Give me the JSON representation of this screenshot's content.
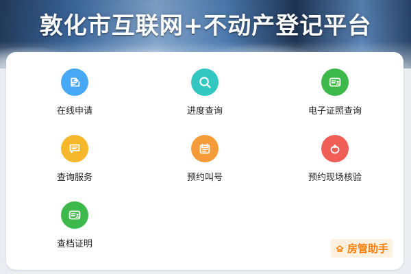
{
  "header": {
    "title": "敦化市互联网+不动产登记平台"
  },
  "menu": {
    "items": [
      {
        "key": "online_apply",
        "label": "在线申请",
        "icon": "edit-icon",
        "color": "#47A8F5"
      },
      {
        "key": "progress_query",
        "label": "进度查询",
        "icon": "search-icon",
        "color": "#33C7C1"
      },
      {
        "key": "e_certificate_query",
        "label": "电子证照查询",
        "icon": "certificate-icon",
        "color": "#3DB84A"
      },
      {
        "key": "query_service",
        "label": "查询服务",
        "icon": "message-icon",
        "color": "#F6B72A"
      },
      {
        "key": "appointment_number",
        "label": "预约叫号",
        "icon": "calendar-icon",
        "color": "#F59B37"
      },
      {
        "key": "appointment_site_check",
        "label": "预约现场核验",
        "icon": "shield-flower-icon",
        "color": "#F15E57"
      },
      {
        "key": "archive_certificate",
        "label": "查档证明",
        "icon": "certificate-icon",
        "color": "#3DB84A"
      }
    ]
  },
  "watermark": {
    "text": "房管助手",
    "icon": "house-icon",
    "color": "#FF7A00"
  }
}
